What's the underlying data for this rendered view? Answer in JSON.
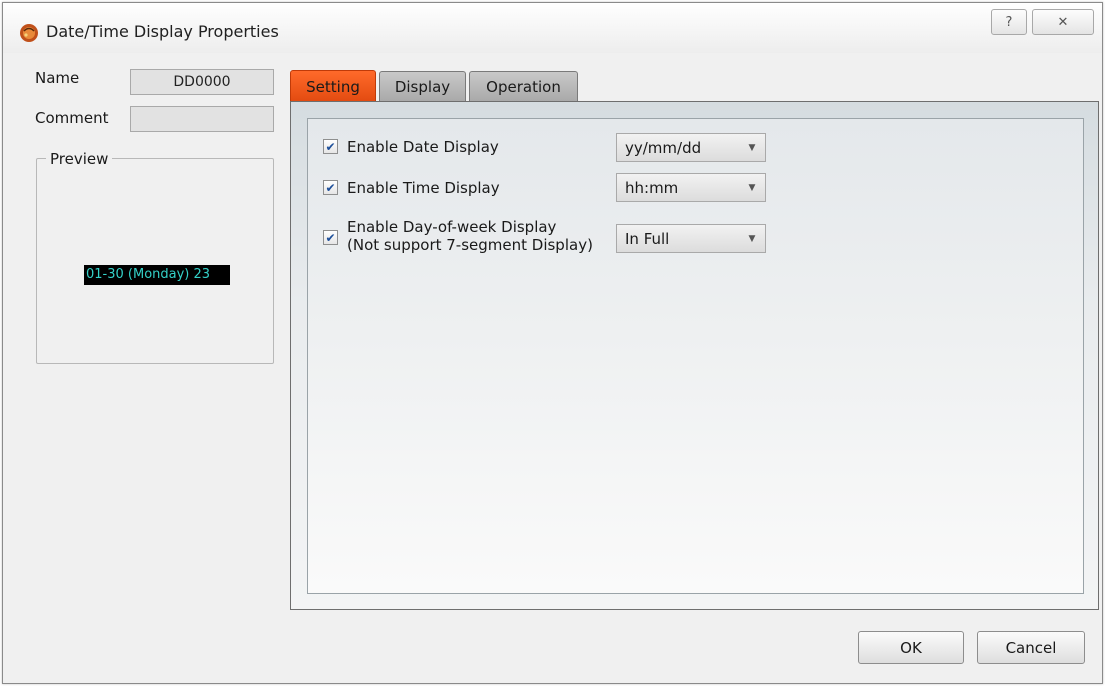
{
  "window": {
    "title": "Date/Time Display Properties",
    "help_icon": "?",
    "close_icon": "✕"
  },
  "left": {
    "name_label": "Name",
    "name_value": "DD0000",
    "comment_label": "Comment",
    "comment_value": "",
    "preview_label": "Preview",
    "preview_text": "01-30 (Monday) 23"
  },
  "tabs": [
    {
      "label": "Setting",
      "active": true
    },
    {
      "label": "Display",
      "active": false
    },
    {
      "label": "Operation",
      "active": false
    }
  ],
  "settings": {
    "date": {
      "label": "Enable Date Display",
      "checked": true,
      "value": "yy/mm/dd"
    },
    "time": {
      "label": "Enable Time Display",
      "checked": true,
      "value": "hh:mm"
    },
    "dow": {
      "label_line1": "Enable Day-of-week Display",
      "label_line2": "(Not support 7-segment Display)",
      "checked": true,
      "value": "In Full"
    }
  },
  "buttons": {
    "ok": "OK",
    "cancel": "Cancel"
  },
  "colors": {
    "active_tab": "#ff6a2a",
    "preview_bg": "#000000",
    "preview_text": "#34d1c8"
  }
}
